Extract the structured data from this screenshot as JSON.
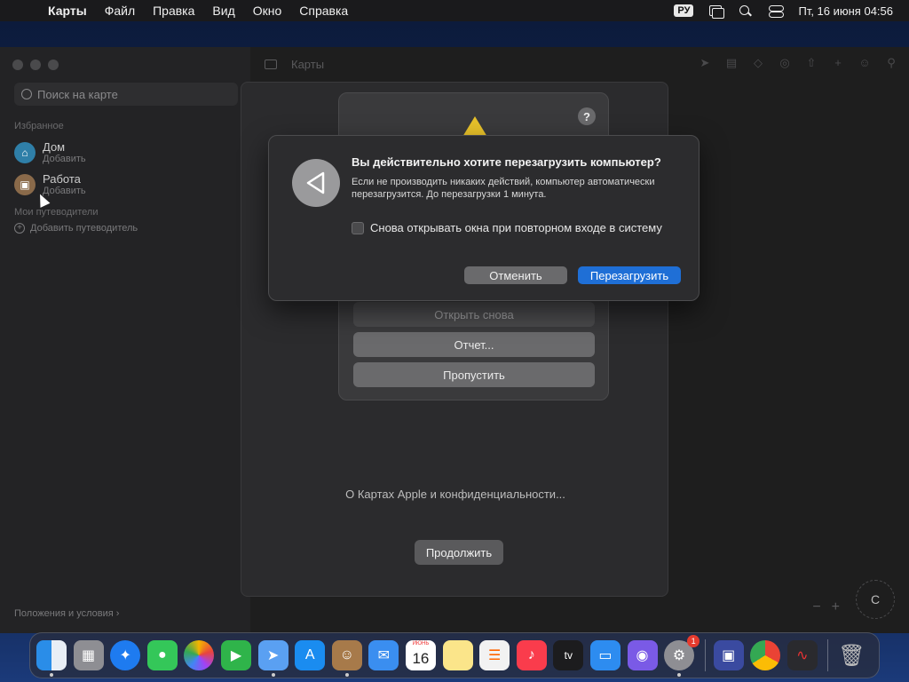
{
  "menubar": {
    "app_name": "Карты",
    "items": [
      "Файл",
      "Правка",
      "Вид",
      "Окно",
      "Справка"
    ],
    "lang": "РУ",
    "datetime": "Пт, 16 июня 04:56"
  },
  "maps": {
    "window_title": "Карты",
    "search_placeholder": "Поиск на карте",
    "favorites_title": "Избранное",
    "favorites": [
      {
        "name": "Дом",
        "sub": "Добавить"
      },
      {
        "name": "Работа",
        "sub": "Добавить"
      }
    ],
    "guides_title": "Мои путеводители",
    "add_guide": "Добавить путеводитель",
    "terms": "Положения и условия ›",
    "compass_letter": "С"
  },
  "welcome": {
    "privacy_link": "О Картах Apple и конфиденциальности...",
    "continue_label": "Продолжить"
  },
  "crash_dialog": {
    "help": "?",
    "reopen_label": "Открыть снова",
    "report_label": "Отчет...",
    "skip_label": "Пропустить"
  },
  "restart_dialog": {
    "title": "Вы действительно хотите перезагрузить компьютер?",
    "message": "Если не производить никаких действий, компьютер автоматически перезагрузится. До перезагрузки 1 минута.",
    "checkbox_label": "Снова открывать окна при повторном входе в систему",
    "cancel_label": "Отменить",
    "restart_label": "Перезагрузить"
  },
  "dock": {
    "calendar_month": "ИЮНЬ",
    "calendar_day": "16",
    "tv_label": "tv",
    "settings_badge": "1"
  },
  "colors": {
    "accent": "#1f6fd6",
    "warning": "#e8c22a"
  }
}
